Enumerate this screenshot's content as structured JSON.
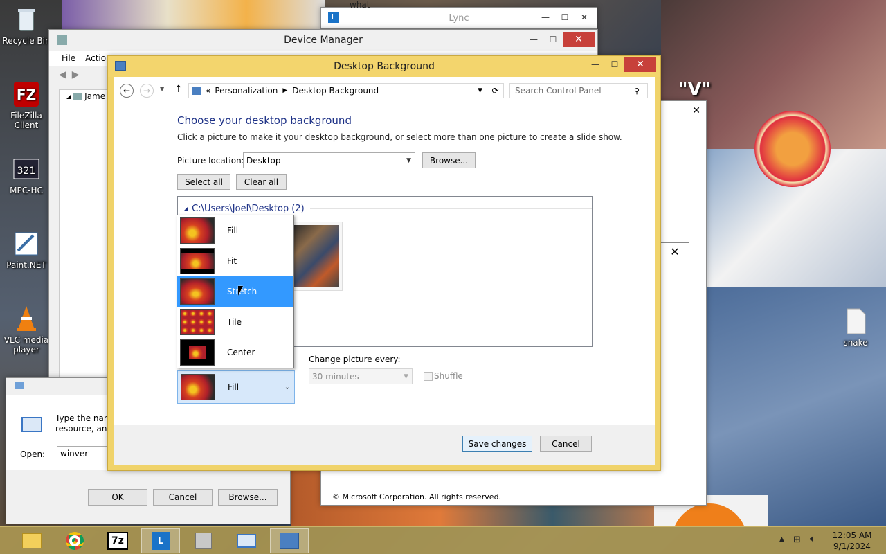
{
  "desktop_icons": [
    {
      "label": "Recycle Bin",
      "icon": "recycle-bin-icon"
    },
    {
      "label": "FileZilla Client",
      "icon": "filezilla-icon"
    },
    {
      "label": "MPC-HC",
      "icon": "mpc-hc-icon"
    },
    {
      "label": "Paint.NET",
      "icon": "paint-net-icon"
    },
    {
      "label": "VLC media player",
      "icon": "vlc-icon"
    },
    {
      "label": "snake",
      "icon": "file-icon"
    }
  ],
  "wallpaper_text": {
    "v_label": "\"V\"",
    "what_label": "what"
  },
  "lync": {
    "title": "Lync"
  },
  "device_manager": {
    "title": "Device Manager",
    "menu": [
      "File",
      "Action"
    ],
    "tree_root": "Jame"
  },
  "run_dialog": {
    "prompt_line1": "Type the name",
    "prompt_line2": "resource, and",
    "open_label": "Open:",
    "open_value": "winver",
    "ok": "OK",
    "cancel": "Cancel",
    "browse": "Browse..."
  },
  "about_dialog": {
    "copyright": "© Microsoft Corporation. All rights reserved."
  },
  "desktop_background": {
    "title": "Desktop Background",
    "breadcrumb": [
      "Personalization",
      "Desktop Background"
    ],
    "search_placeholder": "Search Control Panel",
    "heading": "Choose your desktop background",
    "subtitle": "Click a picture to make it your desktop background, or select more than one picture to create a slide show.",
    "picture_location_label": "Picture location:",
    "picture_location_value": "Desktop",
    "browse": "Browse...",
    "select_all": "Select all",
    "clear_all": "Clear all",
    "group_label": "C:\\Users\\Joel\\Desktop (2)",
    "position_options": [
      "Fill",
      "Fit",
      "Stretch",
      "Tile",
      "Center"
    ],
    "position_highlighted": "Stretch",
    "position_value": "Fill",
    "change_picture_label": "Change picture every:",
    "change_picture_value": "30 minutes",
    "shuffle_label": "Shuffle",
    "save": "Save changes",
    "cancel": "Cancel"
  },
  "taskbar": {
    "time": "12:05 AM",
    "date": "9/1/2024",
    "apps": [
      "file-explorer-icon",
      "chrome-icon",
      "7zip-icon",
      "lync-icon",
      "device-manager-icon",
      "run-icon",
      "control-panel-icon"
    ]
  },
  "colors": {
    "title_accent": "#f3d56d",
    "heading": "#1e3287",
    "selection": "#3399ff",
    "close_red": "#c7403a"
  }
}
